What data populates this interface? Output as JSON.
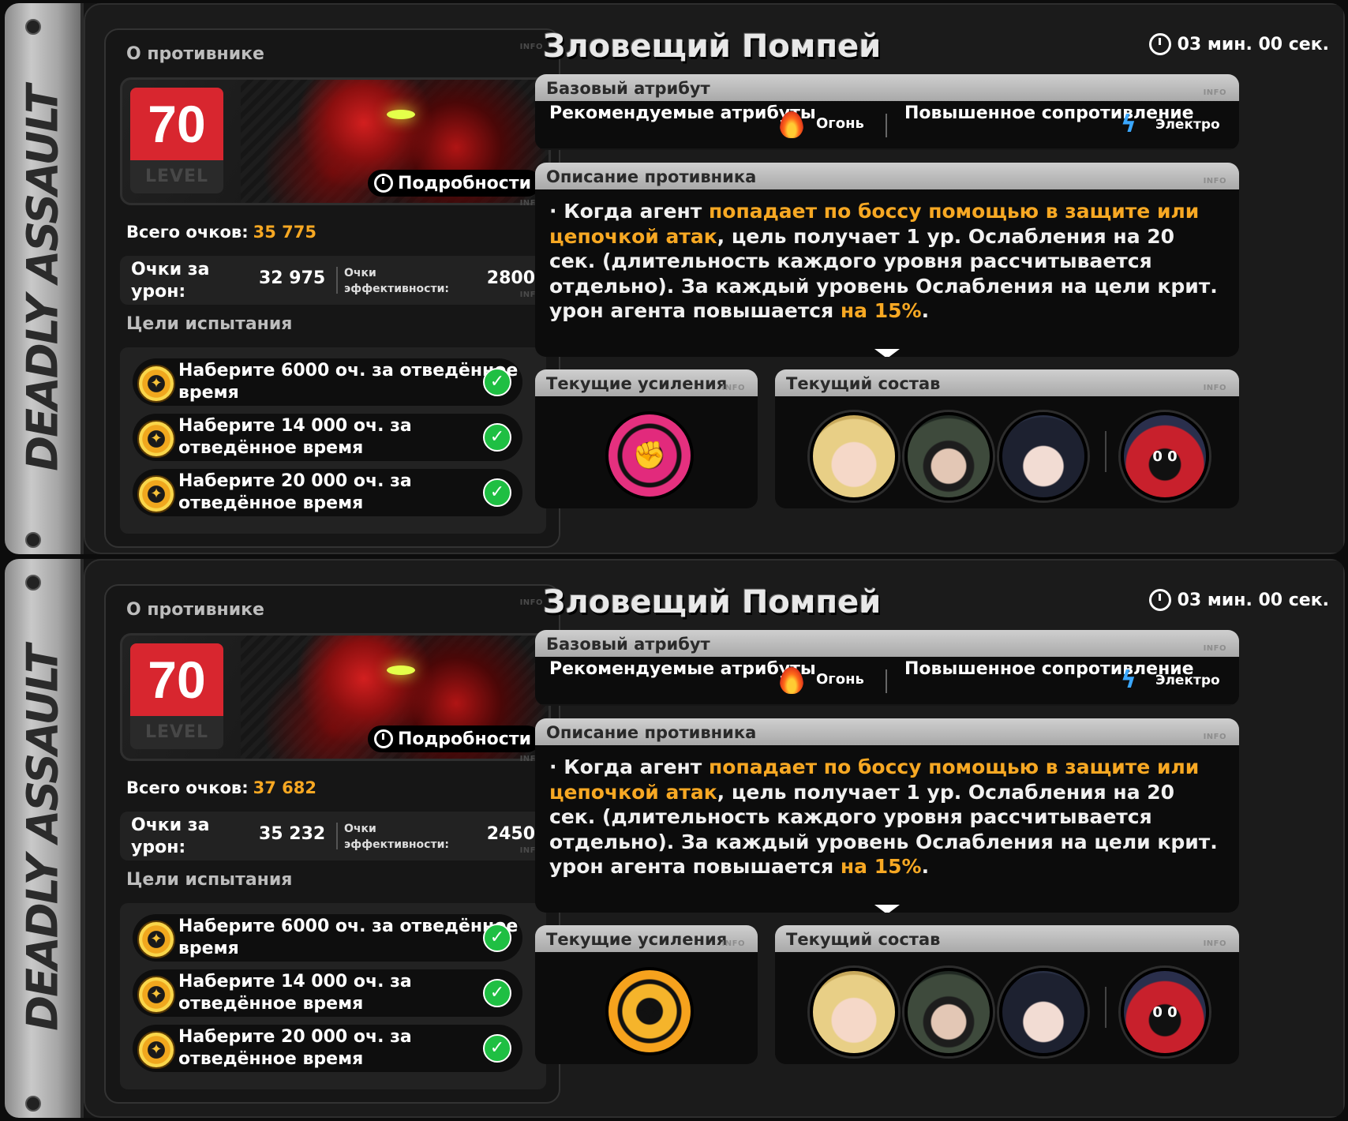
{
  "brand": "DEADLY ASSAULT",
  "panels": [
    {
      "enemy_section_title": "О противнике",
      "info": "INFO",
      "level": "70",
      "level_word": "LEVEL",
      "details_label": "Подробности",
      "total_label": "Всего очков:",
      "total_value": "35 775",
      "damage_label": "Очки за урон:",
      "damage_value": "32 975",
      "efficiency_label": "Очки эффективности:",
      "efficiency_value": "2800",
      "goals_title": "Цели испытания",
      "goals": [
        {
          "text": "Наберите 6000 оч. за отведённое время",
          "done": true
        },
        {
          "text": "Наберите 14 000 оч. за отведённое время",
          "done": true
        },
        {
          "text": "Наберите 20 000 оч. за отведённое время",
          "done": true
        }
      ],
      "boss_name": "Зловещий Помпей",
      "timer": "03 мин. 00 сек.",
      "base_attr_title": "Базовый атрибут",
      "recommended_label": "Рекомендуемые атрибуты",
      "recommended_value": "Огонь",
      "resistance_label": "Повышенное сопротивление",
      "resistance_value": "Электро",
      "desc_title": "Описание противника",
      "desc": {
        "p1": "· Когда агент ",
        "h1": "попадает по боссу помощью в защите или цепочкой атак",
        "p2": ", цель получает 1 ур. Ослабления на 20 сек. (длительность каждого уровня рассчитывается отдельно). За каждый уровень Ослабления на цели крит. урон агента повышается ",
        "h2": "на 15%",
        "p3": "."
      },
      "buffs_title": "Текущие усиления",
      "team_title": "Текущий состав",
      "buff_icon": "fist-buff-icon",
      "buff_color": "#e22a7c"
    },
    {
      "enemy_section_title": "О противнике",
      "info": "INFO",
      "level": "70",
      "level_word": "LEVEL",
      "details_label": "Подробности",
      "total_label": "Всего очков:",
      "total_value": "37 682",
      "damage_label": "Очки за урон:",
      "damage_value": "35 232",
      "efficiency_label": "Очки эффективности:",
      "efficiency_value": "2450",
      "goals_title": "Цели испытания",
      "goals": [
        {
          "text": "Наберите 6000 оч. за отведённое время",
          "done": true
        },
        {
          "text": "Наберите 14 000 оч. за отведённое время",
          "done": true
        },
        {
          "text": "Наберите 20 000 оч. за отведённое время",
          "done": true
        }
      ],
      "boss_name": "Зловещий Помпей",
      "timer": "03 мин. 00 сек.",
      "base_attr_title": "Базовый атрибут",
      "recommended_label": "Рекомендуемые атрибуты",
      "recommended_value": "Огонь",
      "resistance_label": "Повышенное сопротивление",
      "resistance_value": "Электро",
      "desc_title": "Описание противника",
      "desc": {
        "p1": "· Когда агент ",
        "h1": "попадает по боссу помощью в защите или цепочкой атак",
        "p2": ", цель получает 1 ур. Ослабления на 20 сек. (длительность каждого уровня рассчитывается отдельно). За каждый уровень Ослабления на цели крит. урон агента повышается ",
        "h2": "на 15%",
        "p3": "."
      },
      "buffs_title": "Текущие усиления",
      "team_title": "Текущий состав",
      "buff_icon": "gold-emblem-buff-icon",
      "buff_color": "#f5b42b"
    }
  ]
}
